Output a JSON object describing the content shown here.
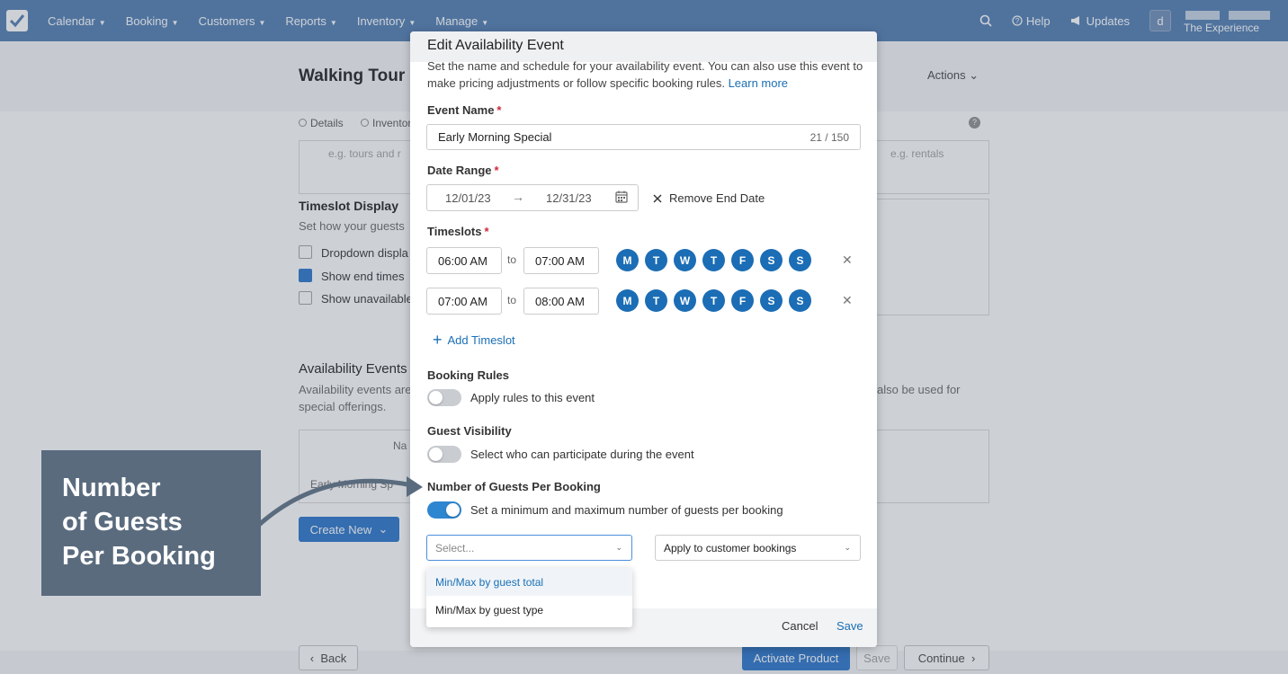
{
  "nav": {
    "items": [
      "Calendar",
      "Booking",
      "Customers",
      "Reports",
      "Inventory",
      "Manage"
    ],
    "help": "Help",
    "updates": "Updates",
    "avatar_letter": "d",
    "account_name": "The Experience",
    "bg_color": "#5f87b8"
  },
  "background": {
    "title": "Walking Tour",
    "actions_label": "Actions",
    "steps": [
      "Details",
      "Inventory"
    ],
    "placeholder_left": "e.g. tours and r",
    "placeholder_right": "e.g. rentals",
    "timeslot_display": {
      "title": "Timeslot Display",
      "subtitle": "Set how your guests",
      "options": [
        {
          "label": "Dropdown displa",
          "checked": false
        },
        {
          "label": "Show end times",
          "checked": true
        },
        {
          "label": "Show unavailable",
          "checked": false
        }
      ]
    },
    "availability": {
      "title": "Availability Events",
      "desc_line1": "Availability events are",
      "desc_line2": "special offerings.",
      "desc_right": "also be used for",
      "table_header": "Na",
      "row_name": "Early Morning Sp",
      "create_new": "Create New"
    },
    "footer": {
      "back": "Back",
      "activate": "Activate Product",
      "save": "Save",
      "continue": "Continue"
    }
  },
  "modal": {
    "title": "Edit Availability Event",
    "description": "Set the name and schedule for your availability event. You can also use this event to make pricing adjustments or follow specific booking rules.",
    "learn_more": "Learn more",
    "event_name": {
      "label": "Event Name",
      "required": "*",
      "value": "Early Morning Special",
      "counter": "21 / 150"
    },
    "date_range": {
      "label": "Date Range",
      "required": "*",
      "start": "12/01/23",
      "end": "12/31/23",
      "remove_end": "Remove End Date"
    },
    "timeslots": {
      "label": "Timeslots",
      "required": "*",
      "to_label": "to",
      "rows": [
        {
          "start": "06:00 AM",
          "end": "07:00 AM",
          "days": [
            "M",
            "T",
            "W",
            "T",
            "F",
            "S",
            "S"
          ]
        },
        {
          "start": "07:00 AM",
          "end": "08:00 AM",
          "days": [
            "M",
            "T",
            "W",
            "T",
            "F",
            "S",
            "S"
          ]
        }
      ],
      "add_label": "Add Timeslot"
    },
    "booking_rules": {
      "label": "Booking Rules",
      "toggle_label": "Apply rules to this event",
      "enabled": false
    },
    "guest_visibility": {
      "label": "Guest Visibility",
      "toggle_label": "Select who can participate during the event",
      "enabled": false
    },
    "guests_per_booking": {
      "label": "Number of Guests Per Booking",
      "toggle_label": "Set a minimum and maximum number of guests per booking",
      "enabled": true,
      "select_placeholder": "Select...",
      "apply_select_value": "Apply to customer bookings",
      "options": [
        "Min/Max by guest total",
        "Min/Max by guest type"
      ]
    },
    "footer": {
      "cancel": "Cancel",
      "save": "Save"
    },
    "day_color": "#1b6db5",
    "link_color": "#1a6fb5"
  },
  "callout": {
    "lines": [
      "Number",
      "of Guests",
      "Per Booking"
    ],
    "bg_color": "#5a6b7e"
  }
}
